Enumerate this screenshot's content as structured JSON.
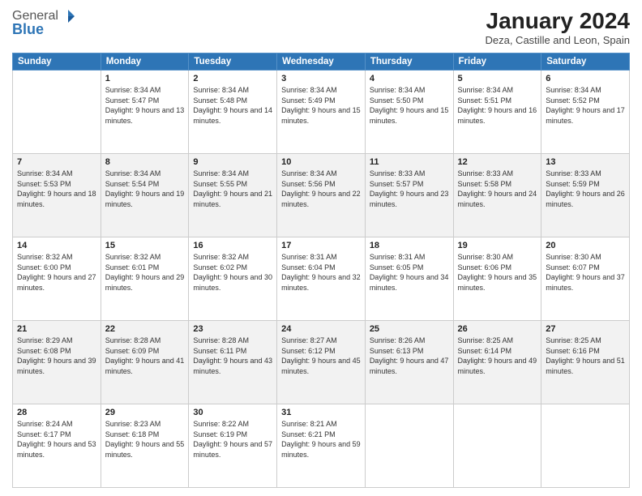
{
  "logo": {
    "general": "General",
    "blue": "Blue"
  },
  "header": {
    "title": "January 2024",
    "subtitle": "Deza, Castille and Leon, Spain"
  },
  "days_header": [
    "Sunday",
    "Monday",
    "Tuesday",
    "Wednesday",
    "Thursday",
    "Friday",
    "Saturday"
  ],
  "weeks": [
    [
      {
        "num": "",
        "sunrise": "",
        "sunset": "",
        "daylight": ""
      },
      {
        "num": "1",
        "sunrise": "Sunrise: 8:34 AM",
        "sunset": "Sunset: 5:47 PM",
        "daylight": "Daylight: 9 hours and 13 minutes."
      },
      {
        "num": "2",
        "sunrise": "Sunrise: 8:34 AM",
        "sunset": "Sunset: 5:48 PM",
        "daylight": "Daylight: 9 hours and 14 minutes."
      },
      {
        "num": "3",
        "sunrise": "Sunrise: 8:34 AM",
        "sunset": "Sunset: 5:49 PM",
        "daylight": "Daylight: 9 hours and 15 minutes."
      },
      {
        "num": "4",
        "sunrise": "Sunrise: 8:34 AM",
        "sunset": "Sunset: 5:50 PM",
        "daylight": "Daylight: 9 hours and 15 minutes."
      },
      {
        "num": "5",
        "sunrise": "Sunrise: 8:34 AM",
        "sunset": "Sunset: 5:51 PM",
        "daylight": "Daylight: 9 hours and 16 minutes."
      },
      {
        "num": "6",
        "sunrise": "Sunrise: 8:34 AM",
        "sunset": "Sunset: 5:52 PM",
        "daylight": "Daylight: 9 hours and 17 minutes."
      }
    ],
    [
      {
        "num": "7",
        "sunrise": "Sunrise: 8:34 AM",
        "sunset": "Sunset: 5:53 PM",
        "daylight": "Daylight: 9 hours and 18 minutes."
      },
      {
        "num": "8",
        "sunrise": "Sunrise: 8:34 AM",
        "sunset": "Sunset: 5:54 PM",
        "daylight": "Daylight: 9 hours and 19 minutes."
      },
      {
        "num": "9",
        "sunrise": "Sunrise: 8:34 AM",
        "sunset": "Sunset: 5:55 PM",
        "daylight": "Daylight: 9 hours and 21 minutes."
      },
      {
        "num": "10",
        "sunrise": "Sunrise: 8:34 AM",
        "sunset": "Sunset: 5:56 PM",
        "daylight": "Daylight: 9 hours and 22 minutes."
      },
      {
        "num": "11",
        "sunrise": "Sunrise: 8:33 AM",
        "sunset": "Sunset: 5:57 PM",
        "daylight": "Daylight: 9 hours and 23 minutes."
      },
      {
        "num": "12",
        "sunrise": "Sunrise: 8:33 AM",
        "sunset": "Sunset: 5:58 PM",
        "daylight": "Daylight: 9 hours and 24 minutes."
      },
      {
        "num": "13",
        "sunrise": "Sunrise: 8:33 AM",
        "sunset": "Sunset: 5:59 PM",
        "daylight": "Daylight: 9 hours and 26 minutes."
      }
    ],
    [
      {
        "num": "14",
        "sunrise": "Sunrise: 8:32 AM",
        "sunset": "Sunset: 6:00 PM",
        "daylight": "Daylight: 9 hours and 27 minutes."
      },
      {
        "num": "15",
        "sunrise": "Sunrise: 8:32 AM",
        "sunset": "Sunset: 6:01 PM",
        "daylight": "Daylight: 9 hours and 29 minutes."
      },
      {
        "num": "16",
        "sunrise": "Sunrise: 8:32 AM",
        "sunset": "Sunset: 6:02 PM",
        "daylight": "Daylight: 9 hours and 30 minutes."
      },
      {
        "num": "17",
        "sunrise": "Sunrise: 8:31 AM",
        "sunset": "Sunset: 6:04 PM",
        "daylight": "Daylight: 9 hours and 32 minutes."
      },
      {
        "num": "18",
        "sunrise": "Sunrise: 8:31 AM",
        "sunset": "Sunset: 6:05 PM",
        "daylight": "Daylight: 9 hours and 34 minutes."
      },
      {
        "num": "19",
        "sunrise": "Sunrise: 8:30 AM",
        "sunset": "Sunset: 6:06 PM",
        "daylight": "Daylight: 9 hours and 35 minutes."
      },
      {
        "num": "20",
        "sunrise": "Sunrise: 8:30 AM",
        "sunset": "Sunset: 6:07 PM",
        "daylight": "Daylight: 9 hours and 37 minutes."
      }
    ],
    [
      {
        "num": "21",
        "sunrise": "Sunrise: 8:29 AM",
        "sunset": "Sunset: 6:08 PM",
        "daylight": "Daylight: 9 hours and 39 minutes."
      },
      {
        "num": "22",
        "sunrise": "Sunrise: 8:28 AM",
        "sunset": "Sunset: 6:09 PM",
        "daylight": "Daylight: 9 hours and 41 minutes."
      },
      {
        "num": "23",
        "sunrise": "Sunrise: 8:28 AM",
        "sunset": "Sunset: 6:11 PM",
        "daylight": "Daylight: 9 hours and 43 minutes."
      },
      {
        "num": "24",
        "sunrise": "Sunrise: 8:27 AM",
        "sunset": "Sunset: 6:12 PM",
        "daylight": "Daylight: 9 hours and 45 minutes."
      },
      {
        "num": "25",
        "sunrise": "Sunrise: 8:26 AM",
        "sunset": "Sunset: 6:13 PM",
        "daylight": "Daylight: 9 hours and 47 minutes."
      },
      {
        "num": "26",
        "sunrise": "Sunrise: 8:25 AM",
        "sunset": "Sunset: 6:14 PM",
        "daylight": "Daylight: 9 hours and 49 minutes."
      },
      {
        "num": "27",
        "sunrise": "Sunrise: 8:25 AM",
        "sunset": "Sunset: 6:16 PM",
        "daylight": "Daylight: 9 hours and 51 minutes."
      }
    ],
    [
      {
        "num": "28",
        "sunrise": "Sunrise: 8:24 AM",
        "sunset": "Sunset: 6:17 PM",
        "daylight": "Daylight: 9 hours and 53 minutes."
      },
      {
        "num": "29",
        "sunrise": "Sunrise: 8:23 AM",
        "sunset": "Sunset: 6:18 PM",
        "daylight": "Daylight: 9 hours and 55 minutes."
      },
      {
        "num": "30",
        "sunrise": "Sunrise: 8:22 AM",
        "sunset": "Sunset: 6:19 PM",
        "daylight": "Daylight: 9 hours and 57 minutes."
      },
      {
        "num": "31",
        "sunrise": "Sunrise: 8:21 AM",
        "sunset": "Sunset: 6:21 PM",
        "daylight": "Daylight: 9 hours and 59 minutes."
      },
      {
        "num": "",
        "sunrise": "",
        "sunset": "",
        "daylight": ""
      },
      {
        "num": "",
        "sunrise": "",
        "sunset": "",
        "daylight": ""
      },
      {
        "num": "",
        "sunrise": "",
        "sunset": "",
        "daylight": ""
      }
    ]
  ]
}
